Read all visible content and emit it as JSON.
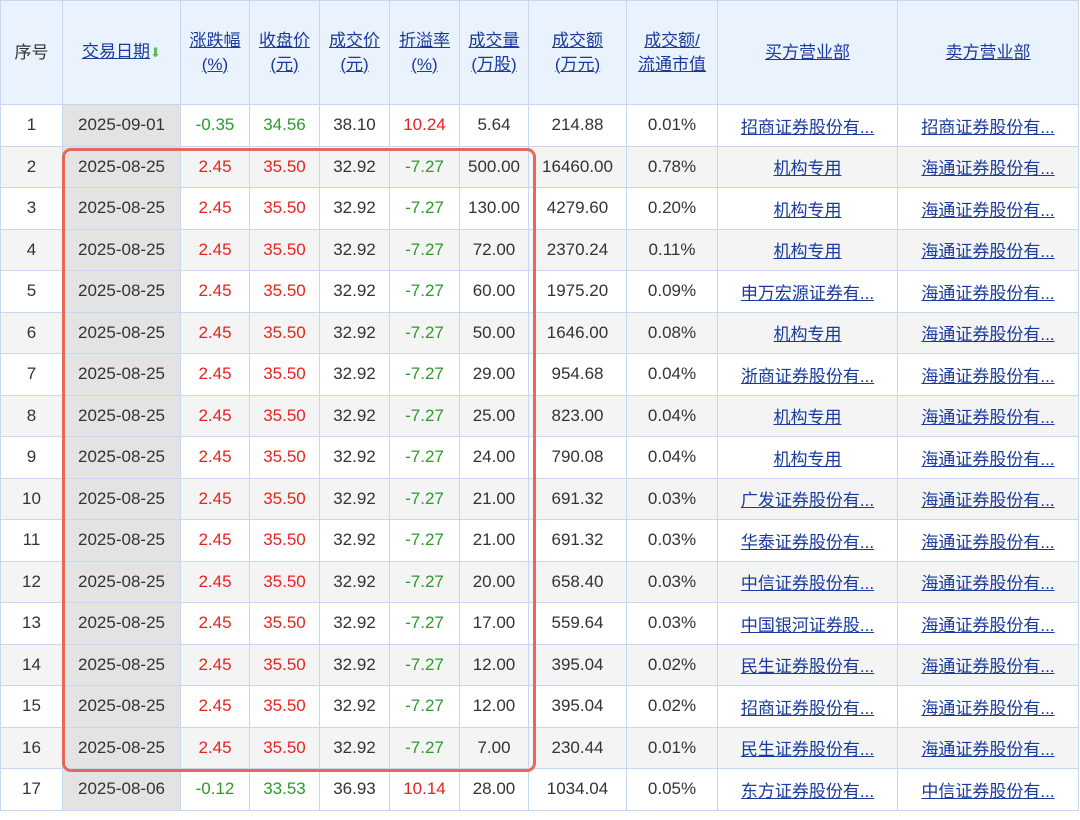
{
  "headers": {
    "seq": "序号",
    "date": "交易日期",
    "chg": [
      "涨跌幅",
      "(%)"
    ],
    "close": [
      "收盘价",
      "(元)"
    ],
    "price": [
      "成交价",
      "(元)"
    ],
    "premium": [
      "折溢率",
      "(%)"
    ],
    "volume": [
      "成交量",
      "(万股)"
    ],
    "amount": [
      "成交额",
      "(万元)"
    ],
    "ratio": [
      "成交额/",
      "流通市值"
    ],
    "buyer": "买方营业部",
    "seller": "卖方营业部"
  },
  "sort_icon": "arrow-down-icon",
  "rows": [
    {
      "seq": "1",
      "date": "2025-09-01",
      "chg": "-0.35",
      "close": "34.56",
      "price": "38.10",
      "premium": "10.24",
      "volume": "5.64",
      "amount": "214.88",
      "ratio": "0.01%",
      "buyer": "招商证券股份有...",
      "seller": "招商证券股份有..."
    },
    {
      "seq": "2",
      "date": "2025-08-25",
      "chg": "2.45",
      "close": "35.50",
      "price": "32.92",
      "premium": "-7.27",
      "volume": "500.00",
      "amount": "16460.00",
      "ratio": "0.78%",
      "buyer": "机构专用",
      "seller": "海通证券股份有..."
    },
    {
      "seq": "3",
      "date": "2025-08-25",
      "chg": "2.45",
      "close": "35.50",
      "price": "32.92",
      "premium": "-7.27",
      "volume": "130.00",
      "amount": "4279.60",
      "ratio": "0.20%",
      "buyer": "机构专用",
      "seller": "海通证券股份有..."
    },
    {
      "seq": "4",
      "date": "2025-08-25",
      "chg": "2.45",
      "close": "35.50",
      "price": "32.92",
      "premium": "-7.27",
      "volume": "72.00",
      "amount": "2370.24",
      "ratio": "0.11%",
      "buyer": "机构专用",
      "seller": "海通证券股份有..."
    },
    {
      "seq": "5",
      "date": "2025-08-25",
      "chg": "2.45",
      "close": "35.50",
      "price": "32.92",
      "premium": "-7.27",
      "volume": "60.00",
      "amount": "1975.20",
      "ratio": "0.09%",
      "buyer": "申万宏源证券有...",
      "seller": "海通证券股份有..."
    },
    {
      "seq": "6",
      "date": "2025-08-25",
      "chg": "2.45",
      "close": "35.50",
      "price": "32.92",
      "premium": "-7.27",
      "volume": "50.00",
      "amount": "1646.00",
      "ratio": "0.08%",
      "buyer": "机构专用",
      "seller": "海通证券股份有..."
    },
    {
      "seq": "7",
      "date": "2025-08-25",
      "chg": "2.45",
      "close": "35.50",
      "price": "32.92",
      "premium": "-7.27",
      "volume": "29.00",
      "amount": "954.68",
      "ratio": "0.04%",
      "buyer": "浙商证券股份有...",
      "seller": "海通证券股份有..."
    },
    {
      "seq": "8",
      "date": "2025-08-25",
      "chg": "2.45",
      "close": "35.50",
      "price": "32.92",
      "premium": "-7.27",
      "volume": "25.00",
      "amount": "823.00",
      "ratio": "0.04%",
      "buyer": "机构专用",
      "seller": "海通证券股份有..."
    },
    {
      "seq": "9",
      "date": "2025-08-25",
      "chg": "2.45",
      "close": "35.50",
      "price": "32.92",
      "premium": "-7.27",
      "volume": "24.00",
      "amount": "790.08",
      "ratio": "0.04%",
      "buyer": "机构专用",
      "seller": "海通证券股份有..."
    },
    {
      "seq": "10",
      "date": "2025-08-25",
      "chg": "2.45",
      "close": "35.50",
      "price": "32.92",
      "premium": "-7.27",
      "volume": "21.00",
      "amount": "691.32",
      "ratio": "0.03%",
      "buyer": "广发证券股份有...",
      "seller": "海通证券股份有..."
    },
    {
      "seq": "11",
      "date": "2025-08-25",
      "chg": "2.45",
      "close": "35.50",
      "price": "32.92",
      "premium": "-7.27",
      "volume": "21.00",
      "amount": "691.32",
      "ratio": "0.03%",
      "buyer": "华泰证券股份有...",
      "seller": "海通证券股份有..."
    },
    {
      "seq": "12",
      "date": "2025-08-25",
      "chg": "2.45",
      "close": "35.50",
      "price": "32.92",
      "premium": "-7.27",
      "volume": "20.00",
      "amount": "658.40",
      "ratio": "0.03%",
      "buyer": "中信证券股份有...",
      "seller": "海通证券股份有..."
    },
    {
      "seq": "13",
      "date": "2025-08-25",
      "chg": "2.45",
      "close": "35.50",
      "price": "32.92",
      "premium": "-7.27",
      "volume": "17.00",
      "amount": "559.64",
      "ratio": "0.03%",
      "buyer": "中国银河证券股...",
      "seller": "海通证券股份有..."
    },
    {
      "seq": "14",
      "date": "2025-08-25",
      "chg": "2.45",
      "close": "35.50",
      "price": "32.92",
      "premium": "-7.27",
      "volume": "12.00",
      "amount": "395.04",
      "ratio": "0.02%",
      "buyer": "民生证券股份有...",
      "seller": "海通证券股份有..."
    },
    {
      "seq": "15",
      "date": "2025-08-25",
      "chg": "2.45",
      "close": "35.50",
      "price": "32.92",
      "premium": "-7.27",
      "volume": "12.00",
      "amount": "395.04",
      "ratio": "0.02%",
      "buyer": "招商证券股份有...",
      "seller": "海通证券股份有..."
    },
    {
      "seq": "16",
      "date": "2025-08-25",
      "chg": "2.45",
      "close": "35.50",
      "price": "32.92",
      "premium": "-7.27",
      "volume": "7.00",
      "amount": "230.44",
      "ratio": "0.01%",
      "buyer": "民生证券股份有...",
      "seller": "海通证券股份有..."
    },
    {
      "seq": "17",
      "date": "2025-08-06",
      "chg": "-0.12",
      "close": "33.53",
      "price": "36.93",
      "premium": "10.14",
      "volume": "28.00",
      "amount": "1034.04",
      "ratio": "0.05%",
      "buyer": "东方证券股份有...",
      "seller": "中信证券股份有..."
    }
  ],
  "colors": {
    "up": "#e8231e",
    "down": "#2d9a2b",
    "highlight": "#e8665a",
    "header_bg": "#eaf3fd",
    "link": "#1a3a9c"
  }
}
